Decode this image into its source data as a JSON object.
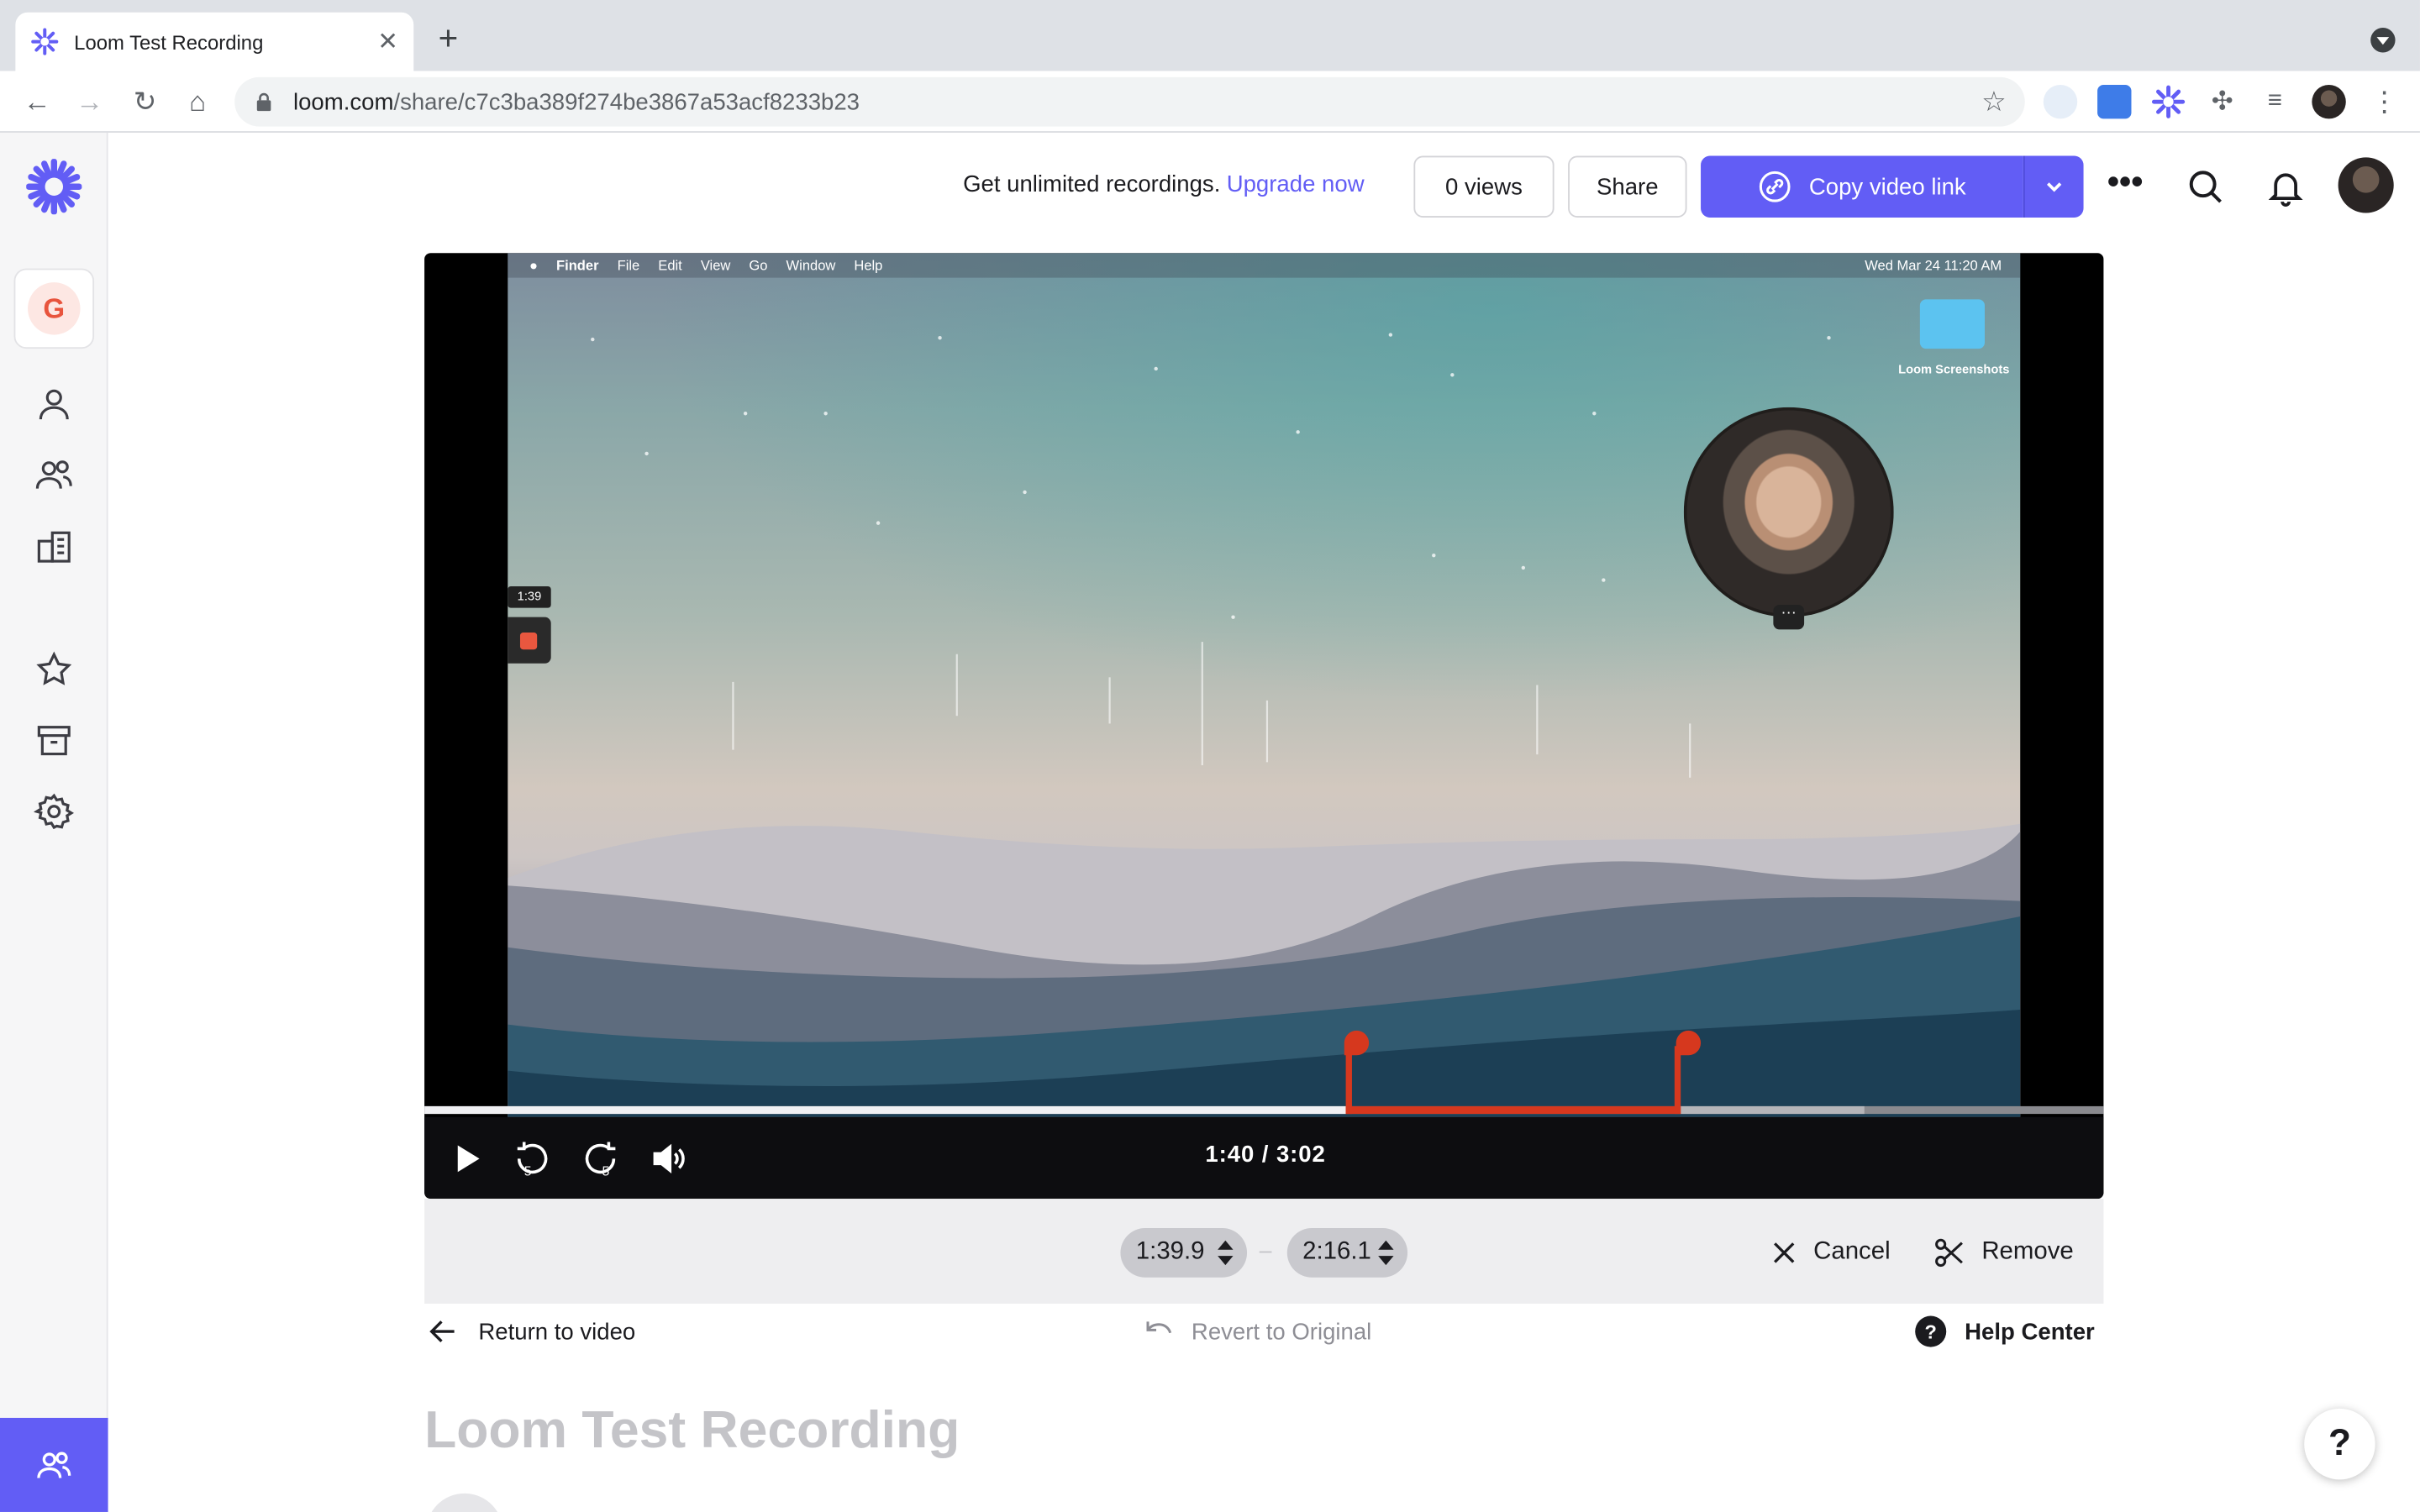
{
  "browser": {
    "tab_title": "Loom Test Recording",
    "url_host": "loom.com",
    "url_path": "/share/c7c3ba389f274be3867a53acf8233b23"
  },
  "header": {
    "promo_text": "Get unlimited recordings.",
    "upgrade_link": "Upgrade now",
    "views_label": "0 views",
    "share_label": "Share",
    "copy_link_label": "Copy video link",
    "accent_color": "#625df5"
  },
  "sidebar": {
    "workspace_initial": "G",
    "items": [
      "person-icon",
      "people-icon",
      "building-icon",
      "star-icon",
      "archive-icon",
      "gear-icon"
    ]
  },
  "video": {
    "mac_menu": [
      "Finder",
      "File",
      "Edit",
      "View",
      "Go",
      "Window",
      "Help"
    ],
    "mac_clock": "Wed Mar 24  11:20 AM",
    "desktop_folder": "Loom Screenshots",
    "recording_time": "1:39",
    "timecode": "1:40 / 3:02",
    "current_seconds": 100,
    "duration_seconds": 182,
    "trim_start_seconds": 99.9,
    "trim_end_seconds": 136.1,
    "buffered_seconds": 156
  },
  "trim": {
    "start_value": "1:39.9",
    "end_value": "2:16.1",
    "cancel_label": "Cancel",
    "remove_label": "Remove",
    "trim_color": "#d6381e"
  },
  "footer": {
    "return_label": "Return to video",
    "revert_label": "Revert to Original",
    "help_label": "Help Center",
    "page_title": "Loom Test Recording",
    "help_fab": "?"
  }
}
